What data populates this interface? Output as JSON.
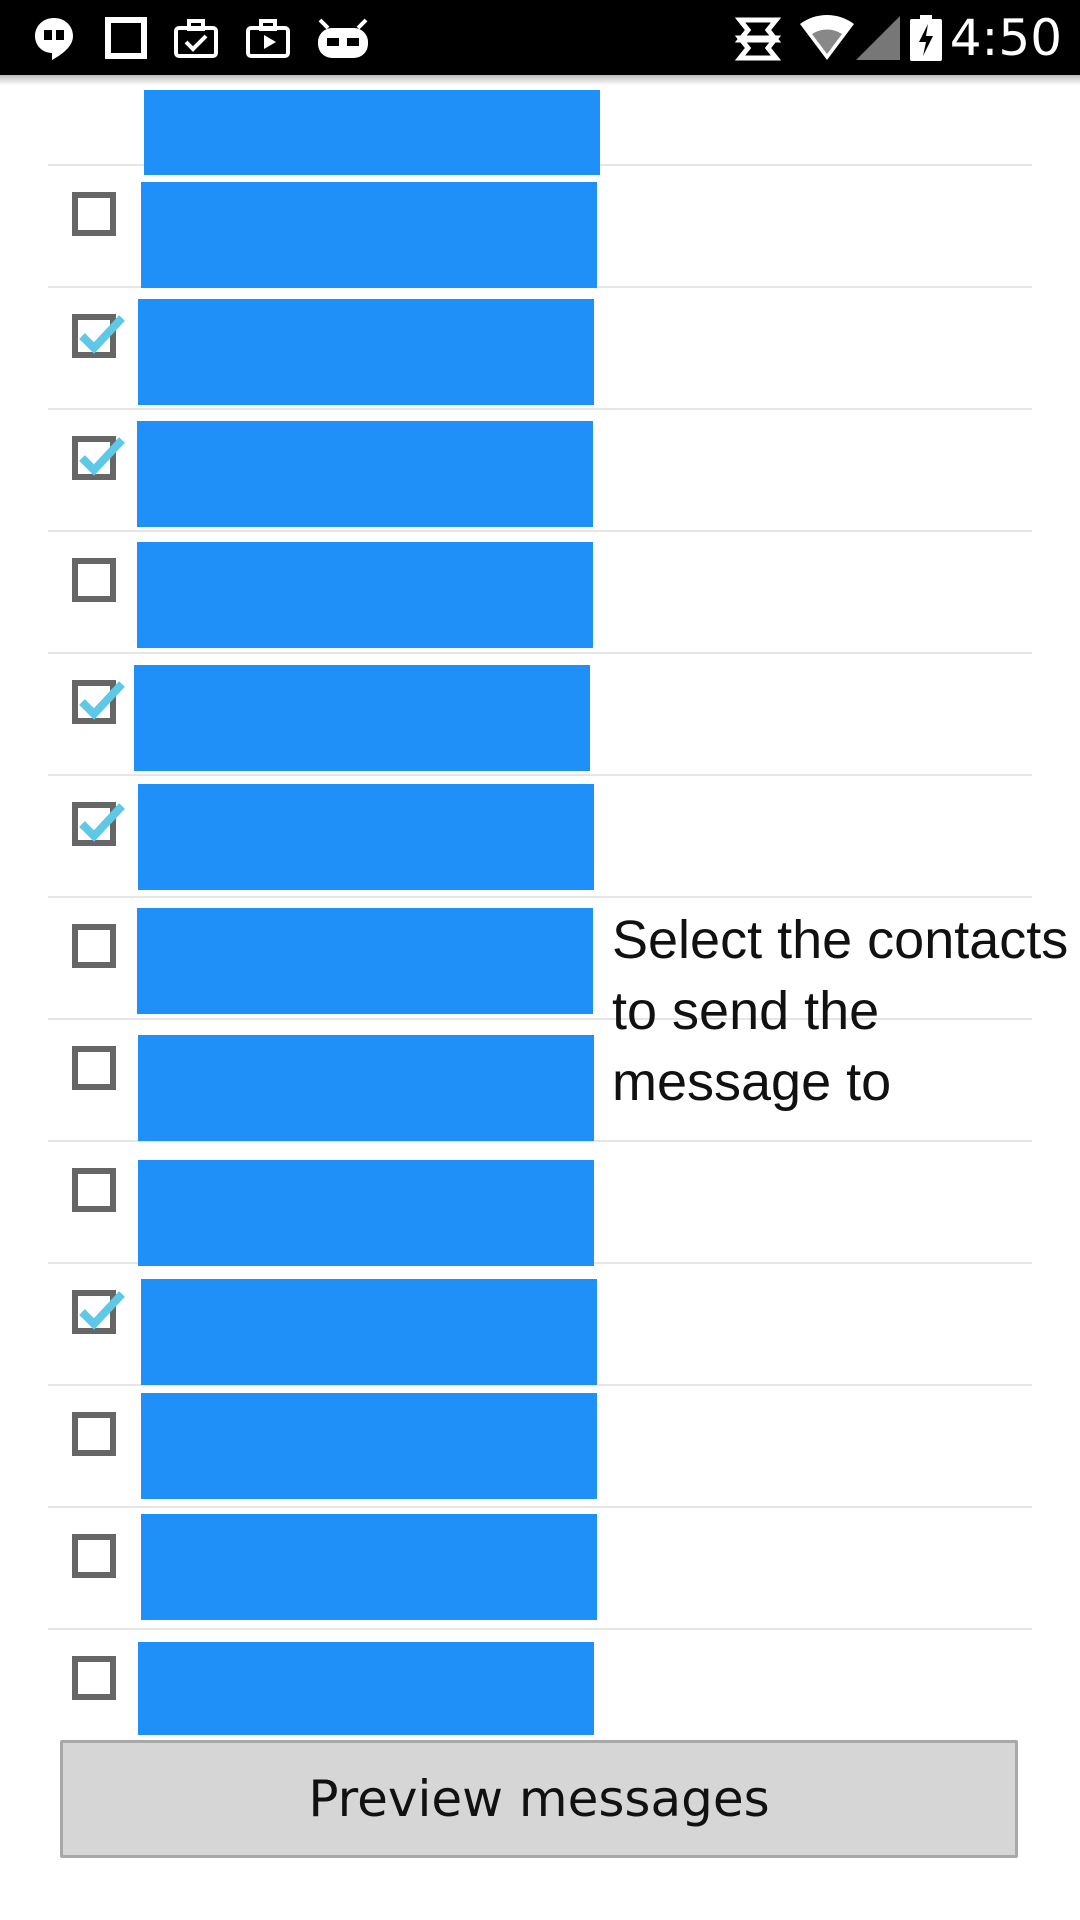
{
  "status_bar": {
    "time": "4:50",
    "left_icons": [
      "hangouts-icon",
      "square-icon",
      "briefcase-check-icon",
      "briefcase-play-icon",
      "cyanogen-icon"
    ],
    "right_icons": [
      "sync-icon",
      "wifi-icon",
      "signal-icon",
      "battery-charging-icon"
    ]
  },
  "colors": {
    "contact_block": "#1e90f8",
    "check_mark": "#5ec8e8",
    "checkbox_border": "#666666",
    "button_bg": "#d6d6d6"
  },
  "contacts": [
    {
      "checked": null
    },
    {
      "checked": false
    },
    {
      "checked": true
    },
    {
      "checked": true
    },
    {
      "checked": false
    },
    {
      "checked": true
    },
    {
      "checked": true
    },
    {
      "checked": false
    },
    {
      "checked": false
    },
    {
      "checked": false
    },
    {
      "checked": true
    },
    {
      "checked": false
    },
    {
      "checked": false
    },
    {
      "checked": false
    }
  ],
  "prompt_text": "Select the contacts to send the message to",
  "preview_button": {
    "label": "Preview messages"
  }
}
